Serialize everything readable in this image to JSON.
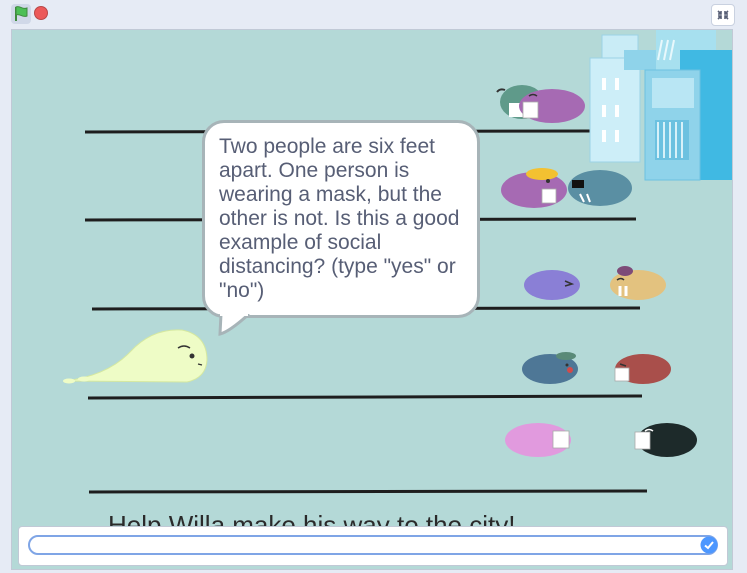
{
  "toolbar": {
    "flag_icon": "green-flag-icon",
    "stop_icon": "stop-icon",
    "fullscreen_icon": "fullscreen-exit-icon"
  },
  "stage": {
    "speech": "Two people are six feet apart. One person is wearing a mask, but the other is not. Is this a good example of social distancing? (type \"yes\" or \"no\")",
    "hint": "Help Willa make his way to the city!",
    "answer_value": "",
    "submit_icon": "check-icon"
  },
  "colors": {
    "stage_bg": "#b4d9d7",
    "line": "#1e1e1e",
    "player": "#eefcc6",
    "city_blue": "#40b9e3"
  }
}
